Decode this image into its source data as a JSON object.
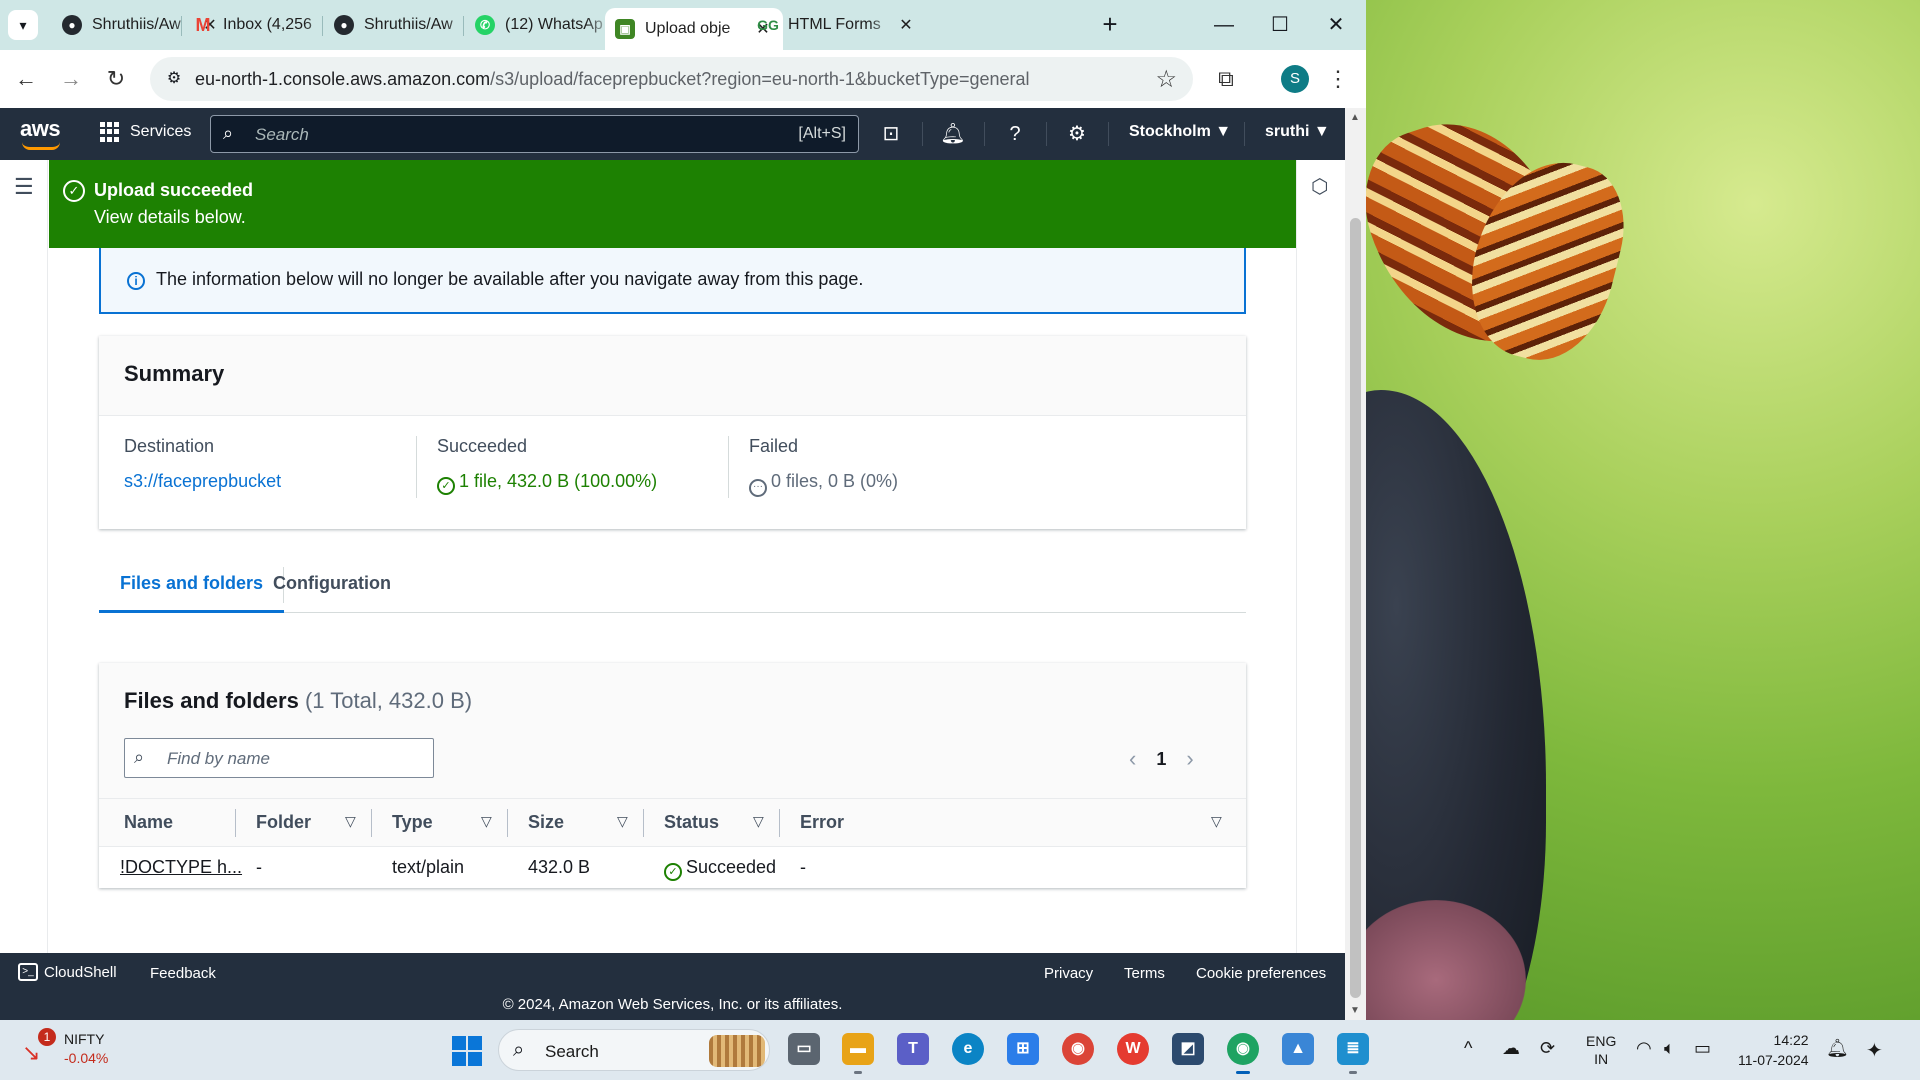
{
  "browser": {
    "tabs": [
      {
        "title": "Shruthiis/Aw",
        "icon": "github-icon"
      },
      {
        "title": "Inbox (4,256",
        "icon": "gmail-icon"
      },
      {
        "title": "Shruthiis/Aw",
        "icon": "github-icon"
      },
      {
        "title": "(12) WhatsAp",
        "icon": "whatsapp-icon"
      },
      {
        "title": "Upload obje",
        "icon": "aws-s3-icon",
        "active": true
      },
      {
        "title": "HTML Forms",
        "icon": "geeksforgeeks-icon"
      }
    ],
    "url_host": "eu-north-1.console.aws.amazon.com",
    "url_path": "/s3/upload/faceprepbucket?region=eu-north-1&bucketType=general",
    "profile_initial": "S"
  },
  "aws": {
    "logo": "aws",
    "services_label": "Services",
    "search_placeholder": "Search",
    "search_shortcut": "[Alt+S]",
    "region": "Stockholm ▼",
    "user": "sruthi ▼",
    "flash": {
      "title": "Upload succeeded",
      "subtitle": "View details below."
    },
    "info_text": "The information below will no longer be available after you navigate away from this page.",
    "summary": {
      "title": "Summary",
      "destination_label": "Destination",
      "destination_value": "s3://faceprepbucket",
      "succeeded_label": "Succeeded",
      "succeeded_value": "1 file, 432.0 B (100.00%)",
      "failed_label": "Failed",
      "failed_value": "0 files, 0 B (0%)"
    },
    "tabs": [
      "Files and folders",
      "Configuration"
    ],
    "files": {
      "title": "Files and folders",
      "count": "(1 Total, 432.0 B)",
      "find_placeholder": "Find by name",
      "page": "1",
      "columns": [
        "Name",
        "Folder",
        "Type",
        "Size",
        "Status",
        "Error"
      ],
      "rows": [
        {
          "name": "!DOCTYPE h...",
          "folder": "-",
          "type": "text/plain",
          "size": "432.0 B",
          "status": "Succeeded",
          "error": "-"
        }
      ]
    },
    "footer": {
      "cloudshell": "CloudShell",
      "feedback": "Feedback",
      "privacy": "Privacy",
      "terms": "Terms",
      "cookies": "Cookie preferences",
      "copyright": "© 2024, Amazon Web Services, Inc. or its affiliates."
    }
  },
  "taskbar": {
    "widget_badge": "1",
    "widget_name": "NIFTY",
    "widget_change": "-0.04%",
    "search_label": "Search",
    "lang_line1": "ENG",
    "lang_line2": "IN",
    "time": "14:22",
    "date": "11-07-2024"
  },
  "colors": {
    "aws_nav": "#232f3e",
    "success": "#1d8102",
    "link": "#0972d3",
    "tabbar": "#cfe7e6"
  }
}
